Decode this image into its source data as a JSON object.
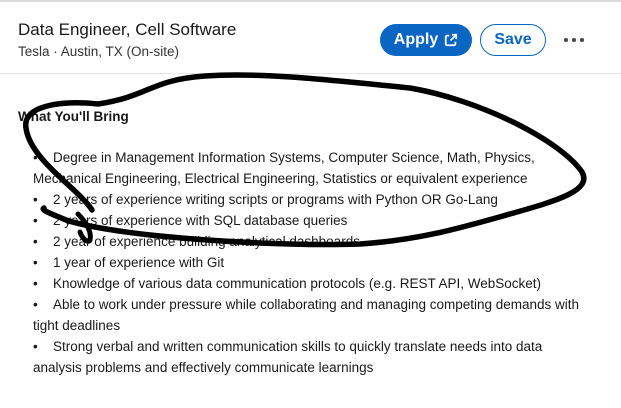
{
  "job": {
    "title": "Data Engineer, Cell Software",
    "subtitle": "Tesla · Austin, TX (On-site)"
  },
  "actions": {
    "apply_label": "Apply",
    "save_label": "Save"
  },
  "section": {
    "heading": "What You'll Bring",
    "items": [
      {
        "text": "Degree in Management Information Systems, Computer Science, Math, Physics, Mechanical Engineering, Electrical Engineering, Statistics or equivalent experience"
      },
      {
        "text": "2 years of experience writing scripts or programs with Python OR Go-Lang"
      },
      {
        "text": "2 years of experience with SQL database queries"
      },
      {
        "text": "2 year of experience building analytical dashboards"
      },
      {
        "text": "1 year of experience with Git"
      },
      {
        "text": "Knowledge of various data communication protocols (e.g. REST API, WebSocket)"
      },
      {
        "text": "Able to work under pressure while collaborating and managing competing demands with tight deadlines"
      },
      {
        "text": "Strong verbal and written communication skills to quickly translate needs into data analysis problems and effectively communicate learnings"
      }
    ]
  },
  "colors": {
    "accent": "#0a66c2",
    "text": "#191919",
    "scribble": "#000000"
  }
}
